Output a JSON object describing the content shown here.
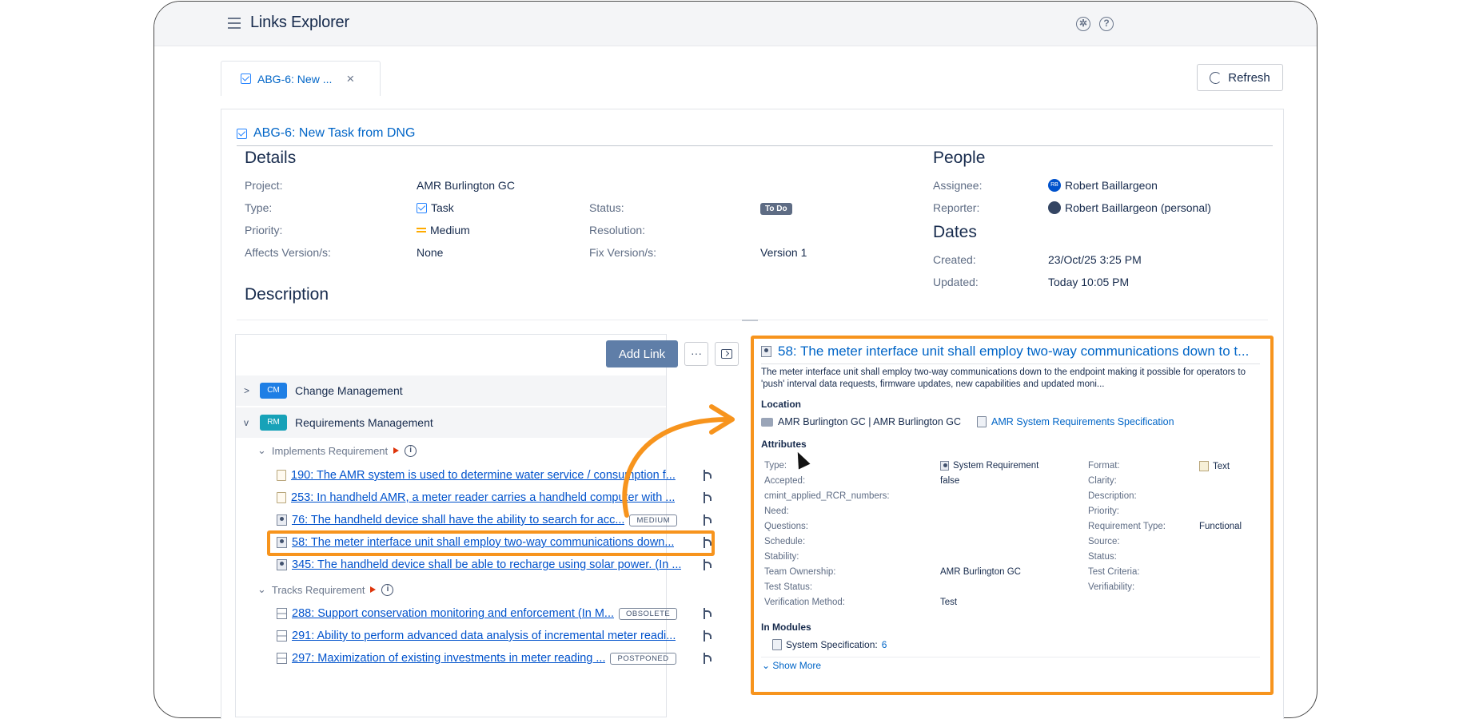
{
  "app": {
    "title": "Links Explorer",
    "settings_icon": "gear-icon",
    "help_icon": "help-icon"
  },
  "tab": {
    "label": "ABG-6: New ...",
    "close": "×"
  },
  "toolbar": {
    "refresh_label": "Refresh"
  },
  "issue": {
    "title": "ABG-6: New Task from DNG",
    "details_heading": "Details",
    "people_heading": "People",
    "dates_heading": "Dates",
    "description_heading": "Description",
    "fields": {
      "project_label": "Project:",
      "project": "AMR Burlington GC",
      "type_label": "Type:",
      "type": "Task",
      "status_label": "Status:",
      "status": "To Do",
      "priority_label": "Priority:",
      "priority": "Medium",
      "resolution_label": "Resolution:",
      "affects_label": "Affects Version/s:",
      "affects": "None",
      "fix_label": "Fix Version/s:",
      "fix": "Version 1",
      "assignee_label": "Assignee:",
      "assignee": "Robert Baillargeon",
      "reporter_label": "Reporter:",
      "reporter": "Robert Baillargeon (personal)",
      "created_label": "Created:",
      "created": "23/Oct/25 3:25 PM",
      "updated_label": "Updated:",
      "updated": "Today 10:05 PM"
    },
    "avatar_initials": "RB"
  },
  "links_panel": {
    "add_link": "Add Link",
    "more": "···",
    "groups": [
      {
        "badge": "CM",
        "title": "Change Management",
        "color": "#1f7fe5",
        "chevron": ">"
      },
      {
        "badge": "RM",
        "title": "Requirements Management",
        "color": "#17a2b8",
        "chevron": "v"
      }
    ],
    "implements": {
      "title": "Implements Requirement",
      "items": [
        {
          "text": "190: The AMR system is used to determine water service / consumption f...",
          "badge": ""
        },
        {
          "text": "253: In handheld AMR, a meter reader carries a handheld computer with ...",
          "badge": ""
        },
        {
          "text": "76: The handheld device shall have the ability to search for acc...",
          "badge": "MEDIUM"
        },
        {
          "text": "58: The meter interface unit shall employ two-way communications down...",
          "badge": ""
        },
        {
          "text": "345: The handheld device shall be able to recharge using solar power. (In ...",
          "badge": ""
        }
      ]
    },
    "tracks": {
      "title": "Tracks Requirement",
      "items": [
        {
          "text": "288: Support conservation monitoring and enforcement (In M...",
          "badge": "OBSOLETE"
        },
        {
          "text": "291: Ability to perform advanced data analysis of incremental meter readi...",
          "badge": ""
        },
        {
          "text": "297: Maximization of existing investments in meter reading ...",
          "badge": "POSTPONED"
        }
      ]
    }
  },
  "preview": {
    "title": "58: The meter interface unit shall employ two-way communications down to t...",
    "description": "The meter interface unit shall employ two-way communications down to the endpoint making it possible for operators to 'push' interval data requests, firmware updates, new capabilities and updated moni...",
    "location_heading": "Location",
    "location_project": "AMR Burlington GC | AMR Burlington GC",
    "location_module": "AMR System Requirements Specification",
    "attributes_heading": "Attributes",
    "attributes_col1": [
      {
        "label": "Type:",
        "value": "System Requirement"
      },
      {
        "label": "Accepted:",
        "value": "false"
      },
      {
        "label": "cmint_applied_RCR_numbers:",
        "value": ""
      },
      {
        "label": "Need:",
        "value": ""
      },
      {
        "label": "Questions:",
        "value": ""
      },
      {
        "label": "Schedule:",
        "value": ""
      },
      {
        "label": "Stability:",
        "value": ""
      },
      {
        "label": "Team Ownership:",
        "value": "AMR Burlington GC"
      },
      {
        "label": "Test Status:",
        "value": ""
      },
      {
        "label": "Verification Method:",
        "value": "Test"
      }
    ],
    "attributes_col2": [
      {
        "label": "Format:",
        "value": "Text"
      },
      {
        "label": "Clarity:",
        "value": ""
      },
      {
        "label": "Description:",
        "value": ""
      },
      {
        "label": "Priority:",
        "value": ""
      },
      {
        "label": "Requirement Type:",
        "value": "Functional"
      },
      {
        "label": "Source:",
        "value": ""
      },
      {
        "label": "Status:",
        "value": ""
      },
      {
        "label": "Test Criteria:",
        "value": ""
      },
      {
        "label": "Verifiability:",
        "value": ""
      }
    ],
    "modules_heading": "In Modules",
    "module_name": "System Specification:",
    "module_count": "6",
    "show_more": "Show More"
  },
  "colors": {
    "highlight": "#f7941d",
    "link": "#0052cc"
  }
}
